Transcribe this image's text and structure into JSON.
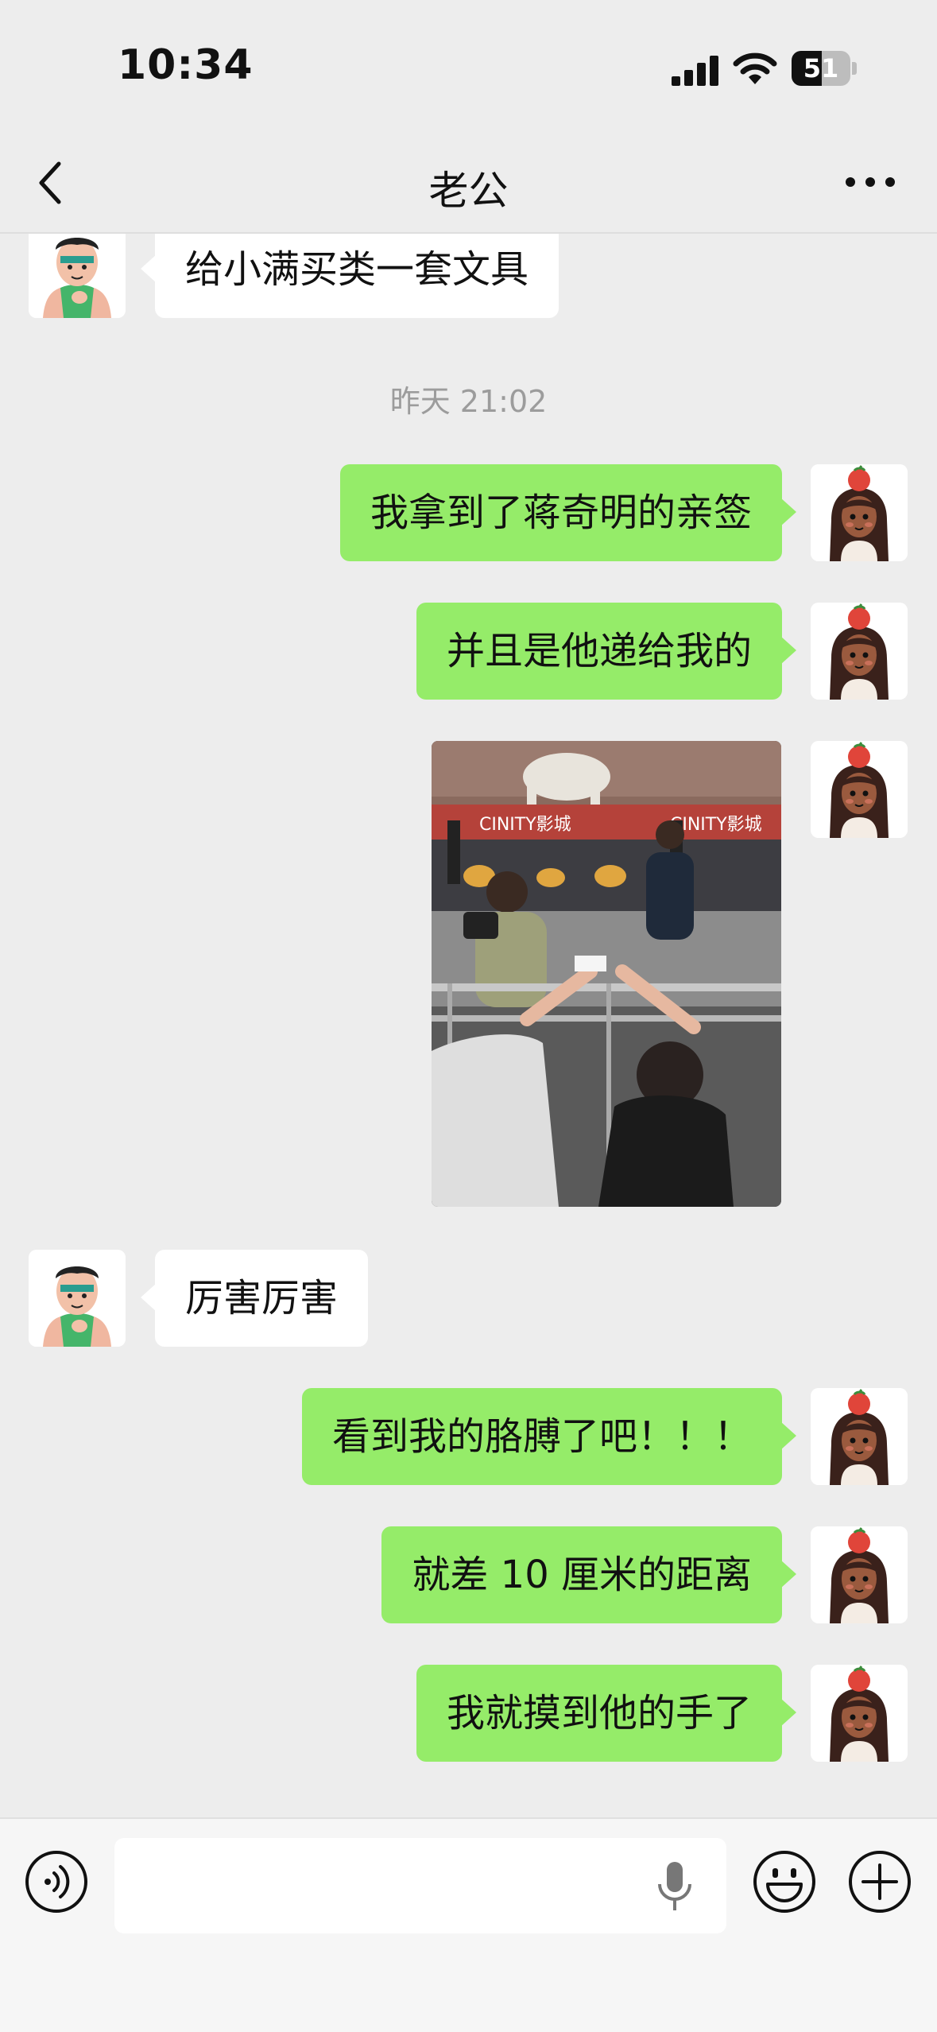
{
  "status_bar": {
    "time": "10:34",
    "battery_level": "51",
    "icons": [
      "signal-icon",
      "wifi-icon",
      "battery-icon"
    ]
  },
  "nav": {
    "title": "老公",
    "back_icon": "chevron-left-icon",
    "more_icon": "more-dots-icon"
  },
  "colors": {
    "background": "#ededed",
    "outgoing_bubble": "#95ec69",
    "incoming_bubble": "#ffffff",
    "timestamp_text": "#9c9c9c"
  },
  "messages": [
    {
      "sender": "contact",
      "type": "text",
      "text": "给小满买类一套文具"
    },
    {
      "type": "timestamp",
      "text": "昨天 21:02"
    },
    {
      "sender": "me",
      "type": "text",
      "text": "我拿到了蒋奇明的亲签"
    },
    {
      "sender": "me",
      "type": "text",
      "text": "并且是他递给我的"
    },
    {
      "sender": "me",
      "type": "image",
      "alt": "photo of a cinema stage event with actor handing signature across barrier"
    },
    {
      "sender": "contact",
      "type": "text",
      "text": "厉害厉害"
    },
    {
      "sender": "me",
      "type": "text",
      "text": "看到我的胳膊了吧！！！"
    },
    {
      "sender": "me",
      "type": "text",
      "text": "就差 10 厘米的距离"
    },
    {
      "sender": "me",
      "type": "text",
      "text": "我就摸到他的手了"
    }
  ],
  "photo": {
    "screen_text": "CINITY影城"
  },
  "input_bar": {
    "placeholder": "",
    "icons": [
      "voice-icon",
      "mic-icon",
      "emoji-icon",
      "plus-icon"
    ]
  }
}
